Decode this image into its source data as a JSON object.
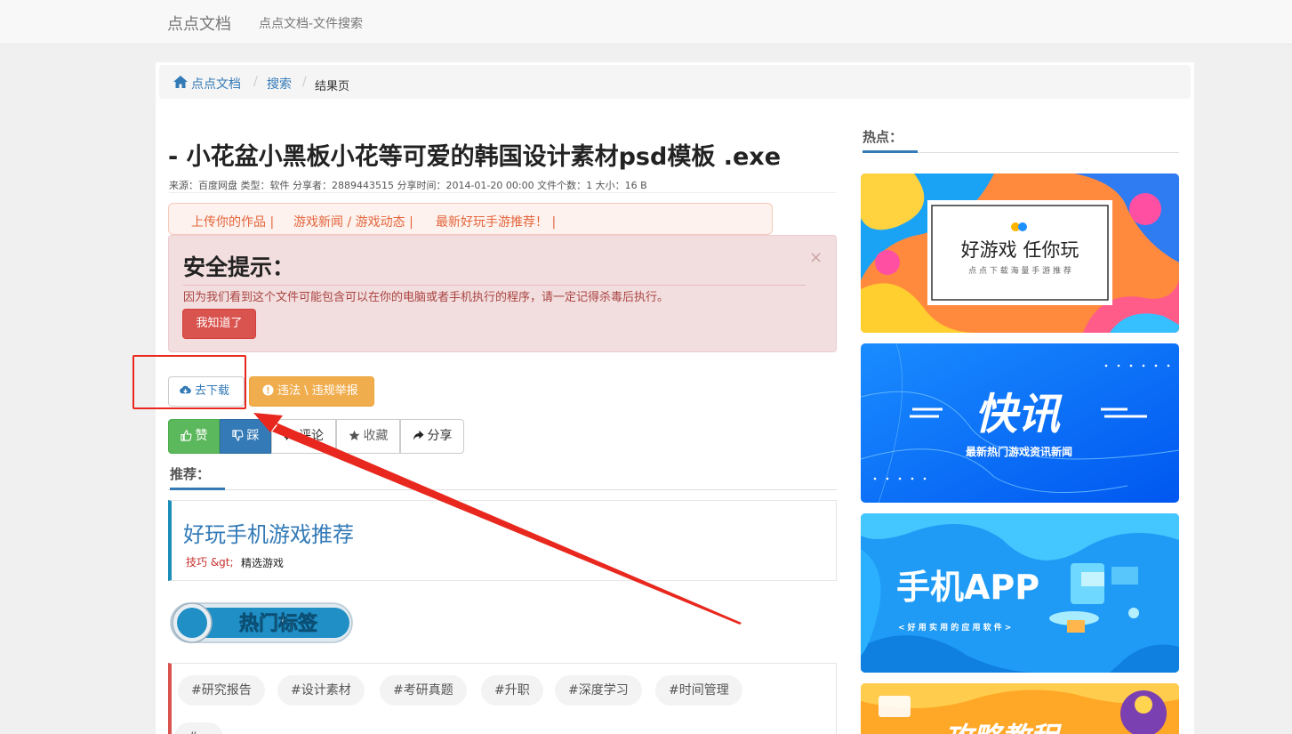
{
  "navbar": {
    "brand": "点点文档",
    "link": "点点文档-文件搜索"
  },
  "breadcrumb": {
    "home": "点点文档",
    "search": "搜索",
    "current": "结果页",
    "sep1": "/",
    "sep2": "/"
  },
  "file": {
    "title": "- 小花盆小黑板小花等可爱的韩国设计素材psd模板 .exe",
    "meta": "来源：百度网盘 类型：软件 分享者：2889443515 分享时间：2014-01-20 00:00 文件个数：1 大小：16 B"
  },
  "linkbar": {
    "item1": "上传你的作品 |",
    "item2": "游戏新闻 / 游戏动态 |",
    "item3": "最新好玩手游推荐！ |"
  },
  "alert": {
    "title": "安全提示：",
    "text": "因为我们看到这个文件可能包含可以在你的电脑或者手机执行的程序，请一定记得杀毒后执行。",
    "button": "我知道了",
    "close": "×"
  },
  "actions": {
    "download": "去下载",
    "report": "违法 \\ 违规举报"
  },
  "social": {
    "like": "赞",
    "dislike": "踩",
    "comment": "评论",
    "favorite": "收藏",
    "share": "分享"
  },
  "recommend": {
    "heading": "推荐：",
    "card_title": "好玩手机游戏推荐",
    "card_tag": "技巧 &gt;",
    "card_sub": "精选游戏"
  },
  "hot_tags": {
    "banner": "热门标签",
    "tags": [
      "#研究报告",
      "#设计素材",
      "#考研真题",
      "#升职",
      "#深度学习",
      "#时间管理",
      "#..."
    ]
  },
  "sidebar": {
    "heading": "热点：",
    "ad1": {
      "title": "好游戏 任你玩",
      "sub": "点 点 下 载 海 量 手 游 推 荐"
    },
    "ad2": {
      "title": "快讯",
      "sub": "最新热门游戏资讯新闻"
    },
    "ad3": {
      "title": "手机APP",
      "sub": "< 好 用 实 用 的 应 用 软 件 >"
    },
    "ad4": {
      "title": "攻略教程"
    }
  },
  "colors": {
    "link": "#337ab7",
    "danger": "#d9534f",
    "warning": "#f0ad4e",
    "success": "#5cb85c",
    "annotation": "#e8281e"
  }
}
